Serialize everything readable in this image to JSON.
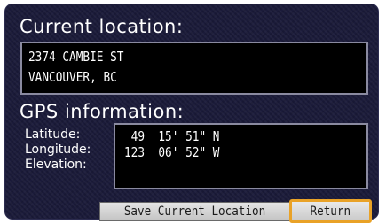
{
  "current_location": {
    "heading": "Current location:",
    "address_line1": "2374 CAMBIE ST",
    "address_line2": "VANCOUVER, BC"
  },
  "gps": {
    "heading": "GPS information:",
    "latitude_label": "Latitude:",
    "longitude_label": "Longitude:",
    "elevation_label": "Elevation:",
    "latitude_value": " 49  15' 51\" N",
    "longitude_value": "123  06' 52\" W",
    "elevation_value": ""
  },
  "buttons": {
    "save_label": "Save Current Location",
    "return_label": "Return"
  },
  "colors": {
    "screen_background": "#1b1b3a",
    "field_background": "#000000",
    "selection_highlight": "#e9a227"
  }
}
